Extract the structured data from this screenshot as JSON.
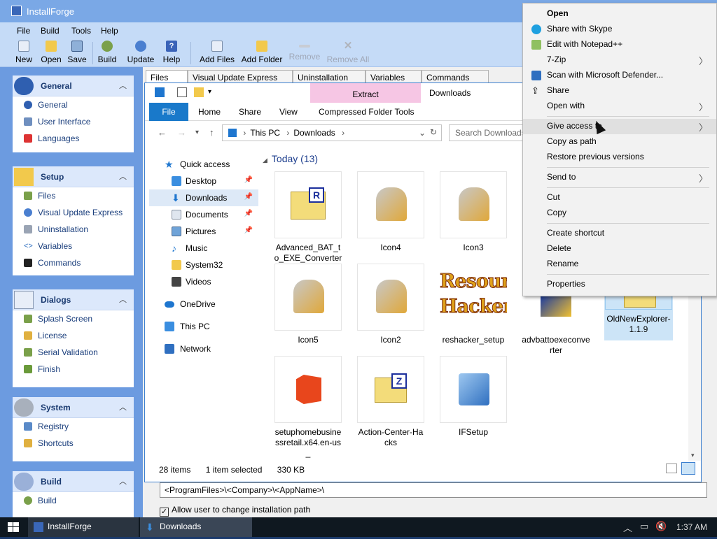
{
  "installforge": {
    "title": "InstallForge",
    "menu": [
      "File",
      "Build",
      "Tools",
      "Help"
    ],
    "toolbar": {
      "new": "New",
      "open": "Open",
      "save": "Save",
      "build": "Build",
      "update": "Update",
      "help": "Help",
      "add_files": "Add Files",
      "add_folder": "Add Folder",
      "remove": "Remove",
      "remove_all": "Remove All"
    },
    "sidebar": {
      "general": {
        "title": "General",
        "items": [
          "General",
          "User Interface",
          "Languages"
        ]
      },
      "setup": {
        "title": "Setup",
        "items": [
          "Files",
          "Visual Update Express",
          "Uninstallation",
          "Variables",
          "Commands"
        ]
      },
      "dialogs": {
        "title": "Dialogs",
        "items": [
          "Splash Screen",
          "License",
          "Serial Validation",
          "Finish"
        ]
      },
      "system": {
        "title": "System",
        "items": [
          "Registry",
          "Shortcuts"
        ]
      },
      "build": {
        "title": "Build",
        "items": [
          "Build"
        ]
      }
    },
    "tabs": [
      "Files",
      "Visual Update Express",
      "Uninstallation",
      "Variables",
      "Commands"
    ],
    "path_value": "<ProgramFiles>\\<Company>\\<AppName>\\",
    "allow_change_label": "Allow user to change installation path"
  },
  "explorer": {
    "contextual_tab": "Extract",
    "window_title": "Downloads",
    "ribbon": [
      "File",
      "Home",
      "Share",
      "View",
      "Compressed Folder Tools"
    ],
    "breadcrumb": [
      "This PC",
      "Downloads"
    ],
    "search_placeholder": "Search Downloads",
    "nav": {
      "quick_access": "Quick access",
      "desktop": "Desktop",
      "downloads": "Downloads",
      "documents": "Documents",
      "pictures": "Pictures",
      "music": "Music",
      "system32": "System32",
      "videos": "Videos",
      "onedrive": "OneDrive",
      "this_pc": "This PC",
      "network": "Network"
    },
    "group_header": "Today (13)",
    "files": [
      {
        "name": "Advanced_BAT_to_EXE_Converter"
      },
      {
        "name": "Icon4"
      },
      {
        "name": "Icon3"
      },
      {
        "name": "Icon5"
      },
      {
        "name": "Icon2"
      },
      {
        "name": "reshacker_setup"
      },
      {
        "name": "advbattoexeconverter"
      },
      {
        "name": "OldNewExplorer-1.1.9"
      },
      {
        "name": "setuphomebusinessretail.x64.en-us_"
      },
      {
        "name": "Action-Center-Hacks"
      },
      {
        "name": "IFSetup"
      }
    ],
    "reshacker_logo": {
      "line1": "Resource",
      "line2": "Hacker"
    },
    "status": {
      "items": "28 items",
      "selected": "1 item selected",
      "size": "330 KB"
    }
  },
  "context_menu": {
    "items": {
      "open": "Open",
      "share_skype": "Share with Skype",
      "edit_npp": "Edit with Notepad++",
      "sevenzip": "7-Zip",
      "defender": "Scan with Microsoft Defender...",
      "share": "Share",
      "open_with": "Open with",
      "give_access": "Give access to",
      "copy_path": "Copy as path",
      "restore": "Restore previous versions",
      "send_to": "Send to",
      "cut": "Cut",
      "copy": "Copy",
      "shortcut": "Create shortcut",
      "delete": "Delete",
      "rename": "Rename",
      "properties": "Properties"
    }
  },
  "taskbar": {
    "app1": "InstallForge",
    "app2": "Downloads",
    "time": "1:37 AM"
  },
  "colors": {
    "accent": "#1979ca",
    "sidebar": "#6c9be0",
    "titlebar": "#7aa8e6",
    "extract_tab": "#f6c6e4"
  }
}
